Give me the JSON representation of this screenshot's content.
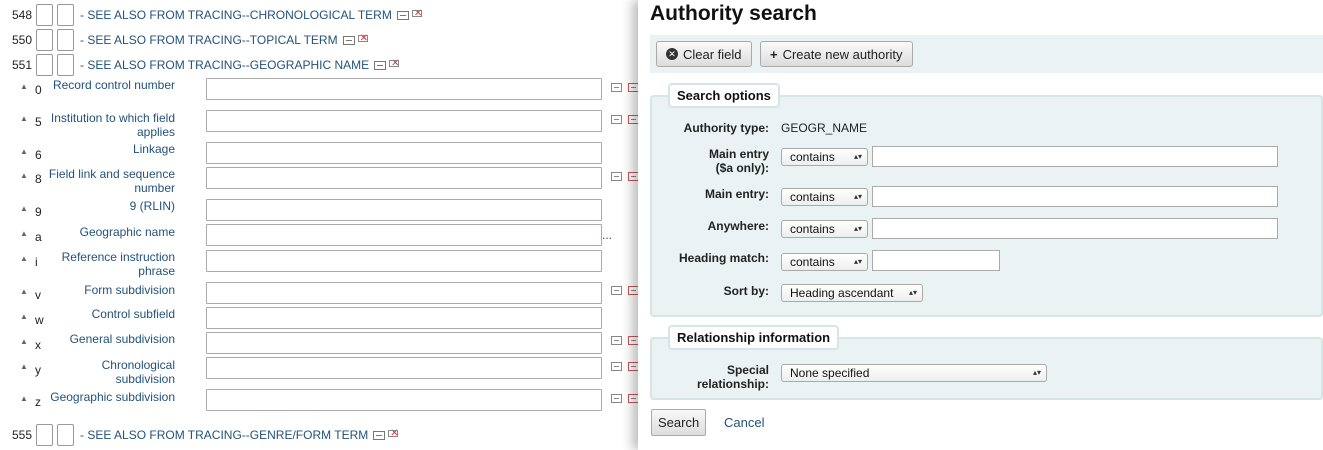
{
  "editor": {
    "tags": [
      {
        "number": "548",
        "label": "- SEE ALSO FROM TRACING--CHRONOLOGICAL TERM"
      },
      {
        "number": "550",
        "label": "- SEE ALSO FROM TRACING--TOPICAL TERM"
      },
      {
        "number": "551",
        "label": "- SEE ALSO FROM TRACING--GEOGRAPHIC NAME"
      },
      {
        "number": "555",
        "label": "- SEE ALSO FROM TRACING--GENRE/FORM TERM"
      }
    ],
    "subfields": [
      {
        "code": "0",
        "label": "Record control number"
      },
      {
        "code": "5",
        "label": "Institution to which field applies"
      },
      {
        "code": "6",
        "label": "Linkage"
      },
      {
        "code": "8",
        "label": "Field link and sequence number"
      },
      {
        "code": "9",
        "label": "9 (RLIN)"
      },
      {
        "code": "a",
        "label": "Geographic name",
        "extra": "..."
      },
      {
        "code": "i",
        "label": "Reference instruction phrase"
      },
      {
        "code": "v",
        "label": "Form subdivision"
      },
      {
        "code": "w",
        "label": "Control subfield"
      },
      {
        "code": "x",
        "label": "General subdivision"
      },
      {
        "code": "y",
        "label": "Chronological subdivision"
      },
      {
        "code": "z",
        "label": "Geographic subdivision"
      }
    ]
  },
  "modal": {
    "title": "Authority search",
    "toolbar": {
      "clear_label": "Clear field",
      "create_label": "Create new authority"
    },
    "search_options": {
      "legend": "Search options",
      "authority_type_label": "Authority type:",
      "authority_type_value": "GEOGR_NAME",
      "main_entry_a_label": "Main entry ($a only):",
      "main_entry_a_op": "contains",
      "main_entry_label": "Main entry:",
      "main_entry_op": "contains",
      "anywhere_label": "Anywhere:",
      "anywhere_op": "contains",
      "heading_match_label": "Heading match:",
      "heading_match_op": "contains",
      "sort_by_label": "Sort by:",
      "sort_by_value": "Heading ascendant"
    },
    "relationship": {
      "legend": "Relationship information",
      "special_label": "Special relationship:",
      "special_value": "None specified"
    },
    "search_label": "Search",
    "cancel_label": "Cancel"
  },
  "colors": {
    "link": "#23527c",
    "panel_bg": "#eaf2f3",
    "panel_border": "#d5e6e6"
  }
}
